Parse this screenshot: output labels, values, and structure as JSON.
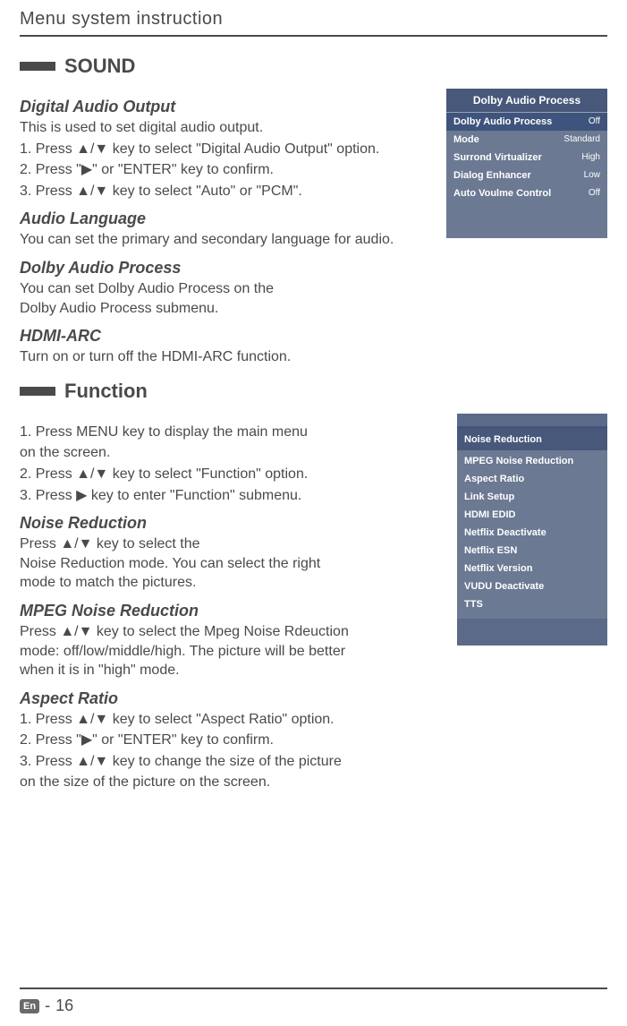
{
  "header": "Menu system instruction",
  "sound": {
    "section_title": "SOUND",
    "digital_audio_output": {
      "title": "Digital Audio Output",
      "intro": "This is used to  set  digital  audio  output.",
      "steps": [
        "1. Press ▲/▼ key to select \"Digital  Audio  Output\" option.",
        "2. Press \"▶\" or \"ENTER\" key to confirm.",
        "3. Press ▲/▼ key to select  \"Auto\" or \"PCM\"."
      ]
    },
    "audio_language": {
      "title": "Audio Language",
      "body": "You can set the primary and secondary language for audio."
    },
    "dolby_process": {
      "title": "Dolby Audio Process",
      "body": "You  can  set  Dolby Audio Process  on  the\nDolby Audio Process submenu."
    },
    "hdmi_arc": {
      "title": "HDMI-ARC",
      "body": "Turn on or turn off the HDMI-ARC function."
    }
  },
  "function": {
    "section_title": "Function",
    "intro_steps": [
      "1. Press MENU key to display the main menu",
      "    on the screen.",
      "2. Press  ▲/▼ key to select \"Function\" option.",
      "3. Press ▶ key to enter \"Function\" submenu."
    ],
    "noise_reduction": {
      "title": "Noise Reduction",
      "body": "Press ▲/▼ key to select the\nNoise Reduction mode. You can select the right\nmode to match the pictures."
    },
    "mpeg_nr": {
      "title": "MPEG Noise Reduction",
      "body": "Press ▲/▼ key to select the Mpeg Noise Rdeuction\nmode: off/low/middle/high. The picture will be better\nwhen it is in \"high\" mode."
    },
    "aspect_ratio": {
      "title": "Aspect Ratio",
      "steps": [
        "1. Press ▲/▼ key to select \"Aspect Ratio\"  option.",
        "2. Press \"▶\" or \"ENTER\" key to confirm.",
        "3. Press ▲/▼ key to change the size of the picture",
        "    on the size of the picture on the screen."
      ]
    }
  },
  "osd_dolby": {
    "title": "Dolby Audio Process",
    "rows": [
      {
        "label": "Dolby Audio Process",
        "value": "Off"
      },
      {
        "label": "Mode",
        "value": "Standard"
      },
      {
        "label": "Surrond  Virtualizer",
        "value": "High"
      },
      {
        "label": "Dialog  Enhancer",
        "value": "Low"
      },
      {
        "label": "Auto Voulme  Control",
        "value": "Off"
      }
    ]
  },
  "osd_function": {
    "title": "Noise Reduction",
    "items": [
      "MPEG Noise Reduction",
      "Aspect Ratio",
      "Link  Setup",
      "HDMI EDID",
      "Netflix Deactivate",
      "Netflix ESN",
      "Netflix Version",
      "VUDU Deactivate",
      "TTS"
    ]
  },
  "footer": {
    "lang": "En",
    "sep": "-",
    "page": "16"
  }
}
